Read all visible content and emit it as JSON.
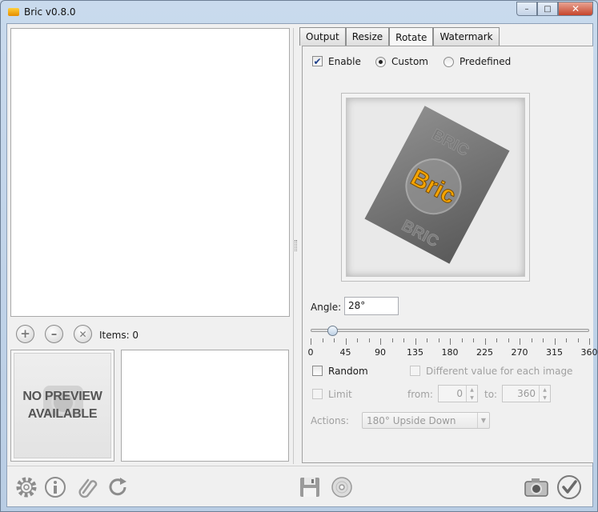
{
  "window": {
    "title": "Bric v0.8.0",
    "minimize_glyph": "–",
    "maximize_glyph": "□",
    "close_glyph": "✕"
  },
  "file_list": {
    "add_glyph": "+",
    "remove_glyph": "–",
    "clear_glyph": "✕",
    "items_label": "Items: 0"
  },
  "preview": {
    "no_preview_line1": "NO PREVIEW",
    "no_preview_line2": "AVAILABLE",
    "logo_text": "Bric",
    "watermark_text": "BRIC"
  },
  "tabs": [
    {
      "label": "Output",
      "active": false
    },
    {
      "label": "Resize",
      "active": false
    },
    {
      "label": "Rotate",
      "active": true
    },
    {
      "label": "Watermark",
      "active": false
    }
  ],
  "rotate": {
    "enable_label": "Enable",
    "enable_checked": true,
    "check_glyph": "✔",
    "custom_label": "Custom",
    "predefined_label": "Predefined",
    "mode_selected": "Custom",
    "angle_label": "Angle:",
    "angle_value": "28°",
    "slider_value": 28,
    "slider_min": 0,
    "slider_max": 360,
    "tick_labels": [
      "0",
      "45",
      "90",
      "135",
      "180",
      "225",
      "270",
      "315",
      "360"
    ],
    "random_label": "Random",
    "different_value_label": "Different value for each image",
    "limit_label": "Limit",
    "from_label": "from:",
    "from_value": "0",
    "to_label": "to:",
    "to_value": "360",
    "spinner_up": "▲",
    "spinner_down": "▼",
    "actions_label": "Actions:",
    "actions_value": "180° Upside Down",
    "combo_arrow": "▼"
  },
  "colors": {
    "title_bar": "#c9daed",
    "close_button": "#c7452c",
    "logo_orange": "#f5a400",
    "panel_bg": "#f0f0f0"
  },
  "toolbar_icons": [
    "settings-gear-icon",
    "info-icon",
    "paperclip-icon",
    "refresh-icon",
    "save-floppy-icon",
    "disc-icon",
    "camera-icon",
    "confirm-check-icon"
  ]
}
